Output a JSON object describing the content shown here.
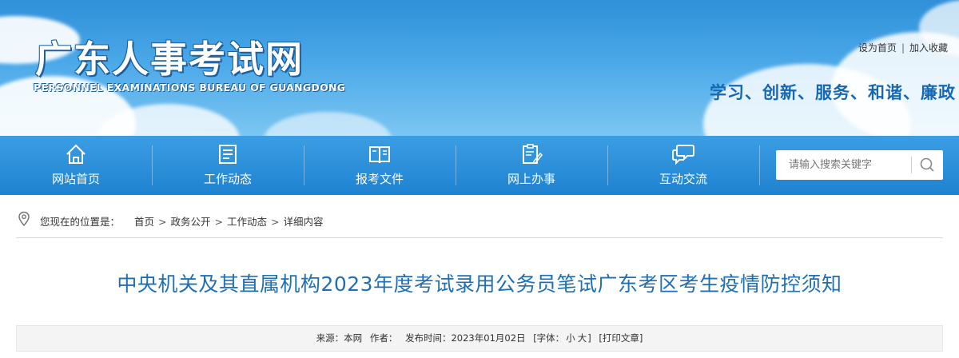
{
  "header": {
    "site_title": "广东人事考试网",
    "site_subtitle": "PERSONNEL EXAMINATIONS BUREAU OF GUANGDONG",
    "links": {
      "set_home": "设为首页",
      "separator": "|",
      "add_favorite": "加入收藏"
    },
    "slogan": "学习、创新、服务、和谐、廉政"
  },
  "nav": {
    "items": [
      {
        "label": "网站首页",
        "icon": "home-icon"
      },
      {
        "label": "工作动态",
        "icon": "news-list-icon"
      },
      {
        "label": "报考文件",
        "icon": "open-book-icon"
      },
      {
        "label": "网上办事",
        "icon": "clipboard-edit-icon"
      },
      {
        "label": "互动交流",
        "icon": "chat-bubbles-icon"
      }
    ],
    "search": {
      "placeholder": "请输入搜索关键字",
      "icon": "search-icon"
    }
  },
  "breadcrumb": {
    "prefix": "您现在的位置是：",
    "icon": "location-pin-icon",
    "items": [
      "首页",
      "政务公开",
      "工作动态",
      "详细内容"
    ],
    "separator": ">"
  },
  "article": {
    "title": "中央机关及其直属机构2023年度考试录用公务员笔试广东考区考生疫情防控须知",
    "meta": {
      "source": "来源：本网",
      "author": "作者：",
      "date": "发布时间：2023年01月02日",
      "font_open": "[字体：",
      "font_small": "小",
      "font_large": "大",
      "font_close": "]",
      "print": "[打印文章]"
    }
  },
  "colors": {
    "nav_bg": "#2a8fdb",
    "title_blue": "#1e6fb5",
    "slogan_blue": "#1667b5"
  }
}
